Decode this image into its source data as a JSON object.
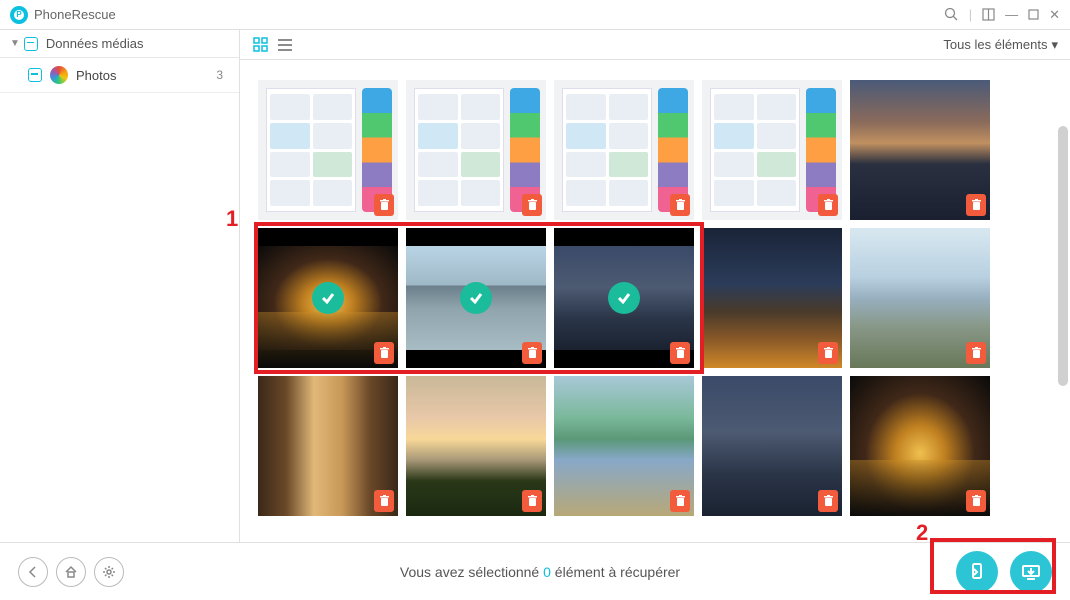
{
  "app": {
    "title": "PhoneRescue"
  },
  "sidebar": {
    "category_label": "Données médias",
    "items": [
      {
        "label": "Photos",
        "count": "3"
      }
    ]
  },
  "toolbar": {
    "filter_label": "Tous les éléments"
  },
  "status": {
    "prefix": "Vous avez sélectionné ",
    "count": "0",
    "suffix": " élément à récupérer"
  },
  "annotations": {
    "one": "1",
    "two": "2"
  },
  "grid": {
    "items": [
      {
        "kind": "phone",
        "deleted": true,
        "selected": false
      },
      {
        "kind": "phone",
        "deleted": true,
        "selected": false
      },
      {
        "kind": "phone",
        "deleted": true,
        "selected": false
      },
      {
        "kind": "phone",
        "deleted": true,
        "selected": false
      },
      {
        "kind": "city-sunset",
        "deleted": true,
        "selected": false
      },
      {
        "kind": "city-bridge",
        "deleted": true,
        "selected": true,
        "bars": true
      },
      {
        "kind": "city-day",
        "deleted": true,
        "selected": true,
        "bars": true
      },
      {
        "kind": "city-dusk",
        "deleted": true,
        "selected": true,
        "bars": true
      },
      {
        "kind": "city-night",
        "deleted": true,
        "selected": false
      },
      {
        "kind": "towers",
        "deleted": true,
        "selected": false
      },
      {
        "kind": "interior",
        "deleted": true,
        "selected": false
      },
      {
        "kind": "sunset-clouds",
        "deleted": true,
        "selected": false
      },
      {
        "kind": "resort",
        "deleted": true,
        "selected": false
      },
      {
        "kind": "city-dusk",
        "deleted": true,
        "selected": false
      },
      {
        "kind": "city-bridge",
        "deleted": true,
        "selected": false
      }
    ]
  }
}
